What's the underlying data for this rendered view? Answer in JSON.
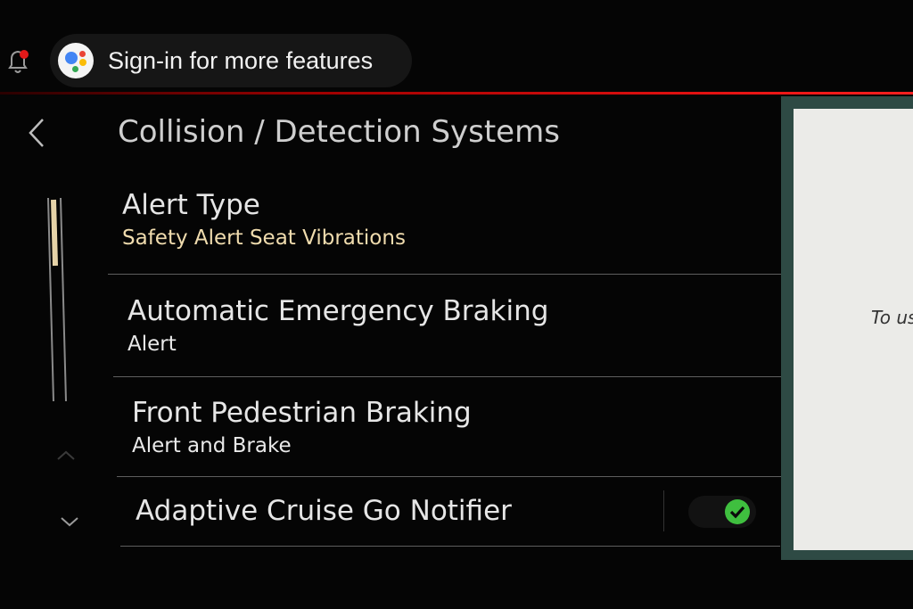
{
  "header": {
    "assistant_label": "Sign-in for more features",
    "notification_icon": "bell-icon",
    "notification_dot_color": "#e11919"
  },
  "page": {
    "title": "Collision / Detection Systems",
    "back_icon": "chevron-left-icon"
  },
  "settings": [
    {
      "title": "Alert Type",
      "value": "Safety Alert Seat Vibrations"
    },
    {
      "title": "Automatic Emergency Braking",
      "value": "Alert"
    },
    {
      "title": "Front Pedestrian Braking",
      "value": "Alert and Brake"
    },
    {
      "title": "Adaptive Cruise Go Notifier",
      "toggle": "on"
    }
  ],
  "side_screen": {
    "text": "To us"
  },
  "colors": {
    "accent_red": "#e01010",
    "value_text": "#f0dcae",
    "toggle_on": "#3fbf3f"
  }
}
